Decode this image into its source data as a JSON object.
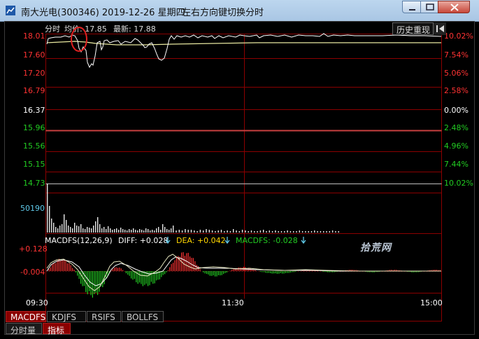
{
  "window": {
    "title": "南大光电(300346) 2019-12-26 星期四",
    "hint": "左右方向键切换分时"
  },
  "header": {
    "label_fenshi": "分时",
    "label_junjia": "均价: 17.85",
    "label_latest": "最新: 17.88",
    "history_button": "历史重现"
  },
  "price_axis": {
    "left": [
      "18.01",
      "17.60",
      "17.20",
      "16.79",
      "16.37",
      "15.96",
      "15.56",
      "15.15",
      "14.73"
    ],
    "right": [
      "10.02%",
      "7.54%",
      "5.06%",
      "2.58%",
      "0.00%",
      "2.48%",
      "4.96%",
      "7.44%",
      "10.02%"
    ]
  },
  "volume_axis": {
    "label": "50190"
  },
  "watermark": "拾荒网",
  "macd": {
    "name": "MACDFS(12,26,9)",
    "diff": "DIFF: +0.028",
    "dea": "DEA: +0.042",
    "macdfs": "MACDFS: -0.028",
    "top": "+0.128",
    "mid": "-0.004"
  },
  "time_axis": [
    "09:30",
    "11:30",
    "15:00"
  ],
  "indicator_tabs": [
    "MACDFS",
    "KDJFS",
    "RSIFS",
    "BOLLFS"
  ],
  "bottom_tabs": [
    "分时量",
    "指标"
  ],
  "colors": {
    "grid": "#8b0000",
    "up": "#ff3333",
    "down": "#22cc22",
    "price_line": "#ffffff",
    "avg_line": "#e8e8a0"
  }
}
